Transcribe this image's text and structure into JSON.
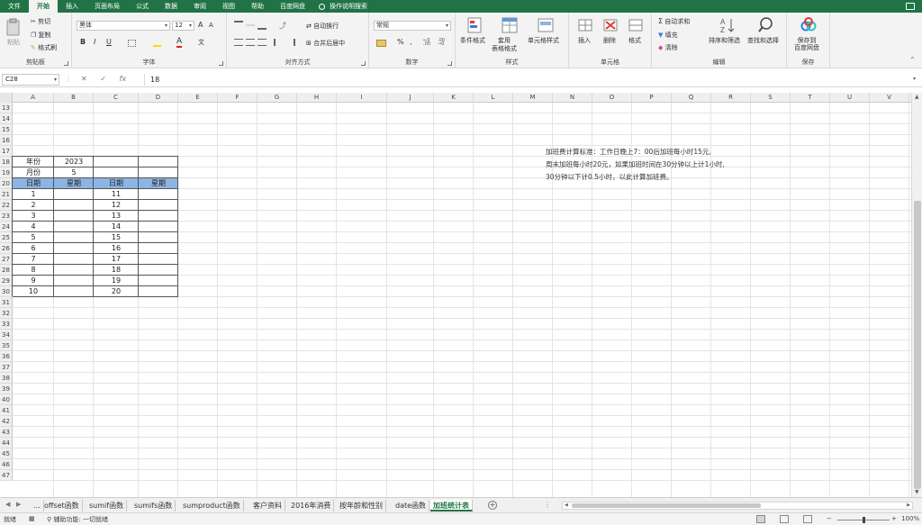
{
  "menu": {
    "items": [
      "文件",
      "开始",
      "插入",
      "页面布局",
      "公式",
      "数据",
      "审阅",
      "视图",
      "帮助",
      "百度网盘"
    ],
    "active_index": 1,
    "tell_me": "操作说明搜索"
  },
  "ribbon": {
    "clipboard": {
      "paste": "粘贴",
      "cut": "剪切",
      "copy": "复制",
      "format_painter": "格式刷",
      "label": "剪贴板"
    },
    "font": {
      "font_name": "黑体",
      "font_size": "12",
      "bold": "B",
      "italic": "I",
      "underline": "U",
      "label": "字体",
      "grow": "A",
      "shrink": "A",
      "font_color": "A",
      "phonetic": "文"
    },
    "alignment": {
      "wrap": "自动换行",
      "merge": "合并后居中",
      "label": "对齐方式"
    },
    "number": {
      "format": "常规",
      "percent": "%",
      "comma": ",",
      "label": "数字"
    },
    "styles": {
      "conditional": "条件格式",
      "table": "套用\n表格格式",
      "cell_styles": "单元格样式",
      "label": "样式"
    },
    "cells": {
      "insert": "插入",
      "delete": "删除",
      "format": "格式",
      "label": "单元格"
    },
    "editing": {
      "autosum": "自动求和",
      "fill": "填充",
      "clear": "清除",
      "sort": "排序和筛选",
      "find": "查找和选择",
      "label": "编辑"
    },
    "save": {
      "save_to": "保存到\n百度网盘",
      "label": "保存"
    }
  },
  "formula_bar": {
    "name_box": "C28",
    "fx": "fx",
    "value": "18"
  },
  "columns": [
    "A",
    "B",
    "C",
    "D",
    "E",
    "F",
    "G",
    "H",
    "I",
    "J",
    "K",
    "L",
    "M",
    "N",
    "O",
    "P",
    "Q",
    "R",
    "S",
    "T",
    "U",
    "V"
  ],
  "rows": [
    13,
    14,
    15,
    16,
    17,
    18,
    19,
    20,
    21,
    22,
    23,
    24,
    25,
    26,
    27,
    28,
    29,
    30,
    31,
    32,
    33,
    34,
    35,
    36,
    37,
    38,
    39,
    40,
    41,
    42,
    43,
    44,
    45,
    46,
    47
  ],
  "table": {
    "year_label": "年份",
    "year_value": "2023",
    "month_label": "月份",
    "month_value": "5",
    "headers": [
      "日期",
      "星期",
      "日期",
      "星期"
    ],
    "left_dates": [
      "1",
      "2",
      "3",
      "4",
      "5",
      "6",
      "7",
      "8",
      "9",
      "10"
    ],
    "right_dates": [
      "11",
      "12",
      "13",
      "14",
      "15",
      "16",
      "17",
      "18",
      "19",
      "20"
    ]
  },
  "notes": [
    "加班费计算标准：工作日晚上7：00后加班每小时15元,",
    "周末加班每小时20元，如果加班时间在30分钟以上计1小时,",
    "30分钟以下计0.5小时，以此计算加班费。"
  ],
  "sheet_tabs": [
    "...",
    "offset函数",
    "sumif函数",
    "sumifs函数",
    "sumproduct函数",
    "客户资料",
    "2016年消费",
    "按年龄和性别",
    "date函数",
    "加班统计表"
  ],
  "active_tab_index": 9,
  "add_sheet": "+",
  "status": {
    "ready": "就绪",
    "accessibility": "辅助功能: 一切就绪",
    "zoom": "100%"
  }
}
